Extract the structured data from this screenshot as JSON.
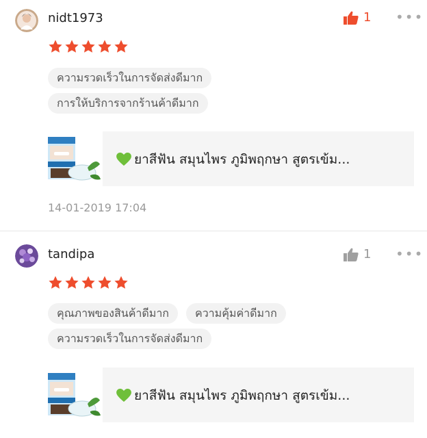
{
  "reviews": [
    {
      "username": "nidt1973",
      "likes": "1",
      "liked": true,
      "rating": 5,
      "tags": [
        "ความรวดเร็วในการจัดส่งดีมาก",
        "การให้บริการจากร้านค้าดีมาก"
      ],
      "product_title": "ยาสีฟัน สมุนไพร ภูมิพฤกษา สูตรเข้ม...",
      "date": "14-01-2019 17:04"
    },
    {
      "username": "tandipa",
      "likes": "1",
      "liked": false,
      "rating": 5,
      "tags": [
        "คุณภาพของสินค้าดีมาก",
        "ความคุ้มค่าดีมาก",
        "ความรวดเร็วในการจัดส่งดีมาก"
      ],
      "product_title": "ยาสีฟัน สมุนไพร ภูมิพฤกษา สูตรเข้ม..."
    }
  ],
  "icons": {
    "like": "thumbs-up-icon",
    "more": "more-dots-icon",
    "star": "star-icon",
    "heart": "green-heart-icon"
  },
  "colors": {
    "accent": "#ee4d2d",
    "star": "#ee4d2d",
    "like_inactive": "#999999",
    "heart": "#6fbf3a"
  },
  "more_glyph": "•••"
}
